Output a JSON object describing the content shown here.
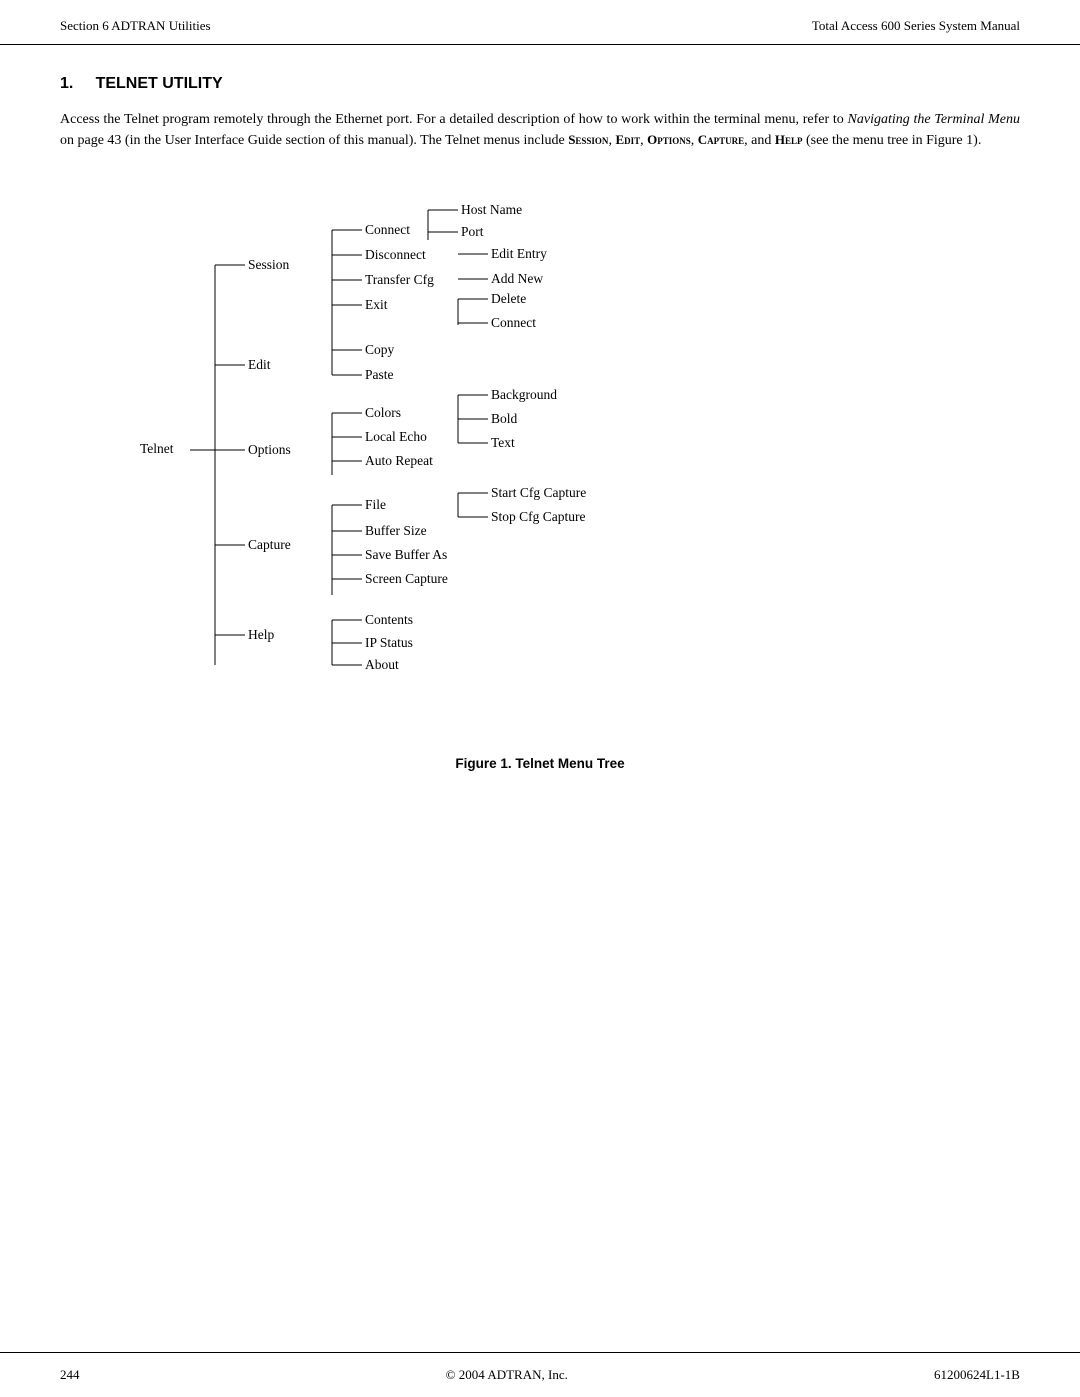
{
  "header": {
    "left": "Section 6  ADTRAN Utilities",
    "right": "Total Access 600 Series System Manual"
  },
  "section": {
    "number": "1.",
    "title": "TELNET UTILITY"
  },
  "body_text": {
    "paragraph": "Access the Telnet program remotely through the Ethernet port. For a detailed description of how to work within the terminal menu, refer to Navigating the Terminal Menu on page 43 (in the User Interface Guide section of this manual). The Telnet menus include SESSION, EDIT, OPTIONS, CAPTURE, and HELP (see the menu tree in Figure 1).",
    "italic_phrase": "Navigating the Terminal Menu",
    "small_caps_items": [
      "SESSION",
      "EDIT",
      "OPTIONS",
      "CAPTURE",
      "HELP"
    ]
  },
  "menu_tree": {
    "root": "Telnet",
    "branches": [
      {
        "label": "Session",
        "items": [
          {
            "label": "Connect",
            "sub": [
              "Host Name",
              "Port"
            ]
          },
          {
            "label": "Disconnect",
            "sub": [
              "Edit Entry"
            ]
          },
          {
            "label": "Transfer Cfg",
            "sub": [
              "Add New"
            ]
          },
          {
            "label": "Exit",
            "sub": [
              "Delete",
              "Connect"
            ]
          }
        ]
      },
      {
        "label": "Edit",
        "items": [
          {
            "label": "Copy",
            "sub": []
          },
          {
            "label": "Paste",
            "sub": []
          }
        ]
      },
      {
        "label": "Options",
        "items": [
          {
            "label": "Colors",
            "sub": [
              "Background",
              "Bold",
              "Text"
            ]
          },
          {
            "label": "Local Echo",
            "sub": []
          },
          {
            "label": "Auto Repeat",
            "sub": []
          }
        ]
      },
      {
        "label": "Capture",
        "items": [
          {
            "label": "File",
            "sub": [
              "Start Cfg Capture",
              "Stop Cfg Capture"
            ]
          },
          {
            "label": "Buffer Size",
            "sub": []
          },
          {
            "label": "Save Buffer As",
            "sub": []
          },
          {
            "label": "Screen Capture",
            "sub": []
          }
        ]
      },
      {
        "label": "Help",
        "items": [
          {
            "label": "Contents",
            "sub": []
          },
          {
            "label": "IP Status",
            "sub": []
          },
          {
            "label": "About",
            "sub": []
          }
        ]
      }
    ]
  },
  "figure_caption": "Figure 1.  Telnet Menu Tree",
  "footer": {
    "left": "244",
    "center": "© 2004 ADTRAN, Inc.",
    "right": "61200624L1-1B"
  }
}
